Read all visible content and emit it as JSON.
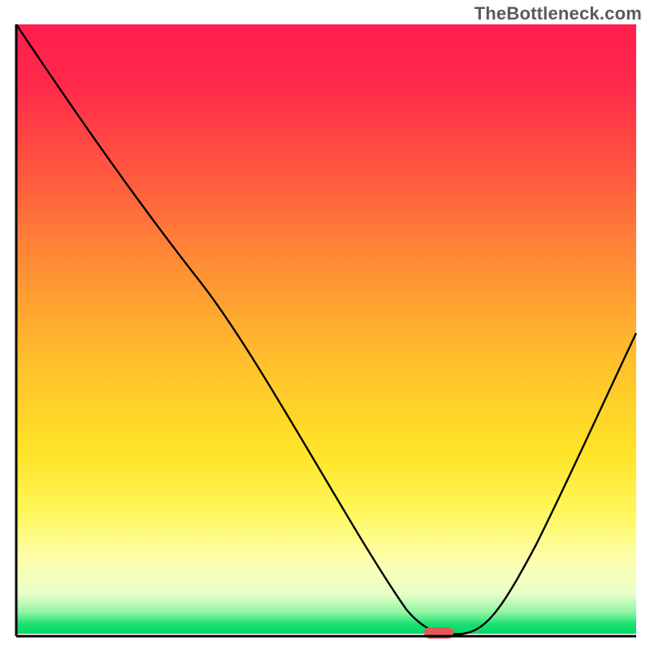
{
  "attribution": "TheBottleneck.com",
  "chart_data": {
    "type": "line",
    "title": "",
    "xlabel": "",
    "ylabel": "",
    "xlim": [
      0,
      100
    ],
    "ylim": [
      0,
      100
    ],
    "grid": false,
    "legend": false,
    "background_gradient": {
      "direction": "vertical",
      "stops": [
        {
          "pos": 0.0,
          "color": "#ff1d4f"
        },
        {
          "pos": 0.25,
          "color": "#ff5a3e"
        },
        {
          "pos": 0.55,
          "color": "#ffbf2c"
        },
        {
          "pos": 0.8,
          "color": "#fff75a"
        },
        {
          "pos": 0.93,
          "color": "#e8ffc8"
        },
        {
          "pos": 1.0,
          "color": "#00d968"
        }
      ]
    },
    "series": [
      {
        "name": "bottleneck-curve",
        "color": "#000000",
        "x": [
          0,
          8,
          16,
          24,
          30,
          38,
          46,
          54,
          60,
          63,
          66,
          70,
          72,
          78,
          86,
          94,
          100
        ],
        "values": [
          100,
          87,
          75,
          64,
          58,
          48,
          36,
          22,
          10,
          3,
          1,
          0,
          1,
          8,
          22,
          38,
          48
        ]
      }
    ],
    "marker": {
      "name": "optimal-point",
      "shape": "pill",
      "color": "#e05a5a",
      "x": 70,
      "y": 0
    }
  }
}
